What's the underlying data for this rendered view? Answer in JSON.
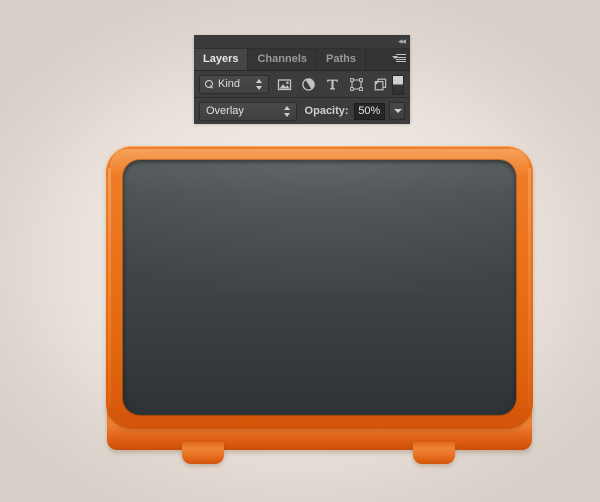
{
  "panel": {
    "titlebar": {
      "collapse_icon": "collapse-to-icons-arrows",
      "collapse_glyph": "◂◂"
    },
    "tabs": [
      {
        "label": "Layers",
        "active": true
      },
      {
        "label": "Channels",
        "active": false
      },
      {
        "label": "Paths",
        "active": false
      }
    ],
    "menu_icon": "panel-menu-hamburger",
    "filter_row": {
      "search_icon": "magnifier-icon",
      "kind_label": "Kind",
      "stepper_icon": "up-down-stepper-arrows",
      "icons": [
        {
          "name": "pixel-layer-filter-icon",
          "title": "Image"
        },
        {
          "name": "adjustment-layer-filter-icon",
          "title": "Adjustment"
        },
        {
          "name": "type-layer-filter-icon",
          "title": "Type"
        },
        {
          "name": "shape-layer-filter-icon",
          "title": "Shape"
        },
        {
          "name": "smart-object-filter-icon",
          "title": "Smart Object"
        }
      ],
      "toggle_icon": "filter-enable-toggle"
    },
    "blend_row": {
      "blend_mode": "Overlay",
      "blend_stepper_icon": "up-down-stepper-arrows",
      "opacity_label": "Opacity:",
      "opacity_value": "50%",
      "opacity_dropdown_icon": "chevron-down-icon"
    }
  },
  "artwork": {
    "name": "orange-retro-tv-illustration",
    "screen_name": "tv-screen",
    "body_name": "tv-body-bezel",
    "base_name": "tv-base-plinth",
    "feet": [
      "tv-foot-left",
      "tv-foot-right"
    ],
    "colors": {
      "background_center": "#f2ebe5",
      "background_edge": "#d6cec7",
      "bezel_orange_light": "#ef7e28",
      "bezel_orange_dark": "#d15409",
      "base_orange_light": "#f08232",
      "base_orange_dark": "#c1480a",
      "screen_top": "#53595b",
      "screen_bottom": "#2c3235"
    }
  }
}
